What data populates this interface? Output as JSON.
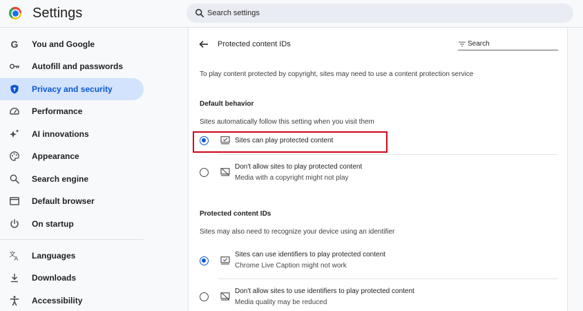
{
  "header": {
    "app_title": "Settings",
    "search_placeholder": "Search settings"
  },
  "sidebar": {
    "items": [
      {
        "label": "You and Google",
        "icon": "google-g-icon"
      },
      {
        "label": "Autofill and passwords",
        "icon": "key-icon"
      },
      {
        "label": "Privacy and security",
        "icon": "shield-icon",
        "active": true
      },
      {
        "label": "Performance",
        "icon": "speedometer-icon"
      },
      {
        "label": "AI innovations",
        "icon": "sparkle-icon"
      },
      {
        "label": "Appearance",
        "icon": "palette-icon"
      },
      {
        "label": "Search engine",
        "icon": "search-icon"
      },
      {
        "label": "Default browser",
        "icon": "browser-window-icon"
      },
      {
        "label": "On startup",
        "icon": "power-icon"
      },
      {
        "label": "Languages",
        "icon": "translate-icon"
      },
      {
        "label": "Downloads",
        "icon": "download-icon"
      },
      {
        "label": "Accessibility",
        "icon": "accessibility-icon"
      }
    ]
  },
  "content": {
    "title": "Protected content IDs",
    "search_placeholder": "Search",
    "intro": "To play content protected by copyright, sites may need to use a content protection service",
    "default_behavior": {
      "heading": "Default behavior",
      "description": "Sites automatically follow this setting when you visit them",
      "options": [
        {
          "label": "Sites can play protected content",
          "sublabel": "",
          "selected": true,
          "icon": "monitor-check-icon"
        },
        {
          "label": "Don't allow sites to play protected content",
          "sublabel": "Media with a copyright might not play",
          "selected": false,
          "icon": "monitor-blocked-icon"
        }
      ]
    },
    "ids_section": {
      "heading": "Protected content IDs",
      "description": "Sites may also need to recognize your device using an identifier",
      "options": [
        {
          "label": "Sites can use identifiers to play protected content",
          "sublabel": "Chrome Live Caption might not work",
          "selected": true,
          "icon": "monitor-check-icon"
        },
        {
          "label": "Don't allow sites to use identifiers to play protected content",
          "sublabel": "Media quality may be reduced",
          "selected": false,
          "icon": "monitor-blocked-icon"
        }
      ]
    }
  },
  "colors": {
    "accent": "#0b57d0",
    "active_nav_bg": "#d3e3fd",
    "highlight": "#d0021b"
  }
}
